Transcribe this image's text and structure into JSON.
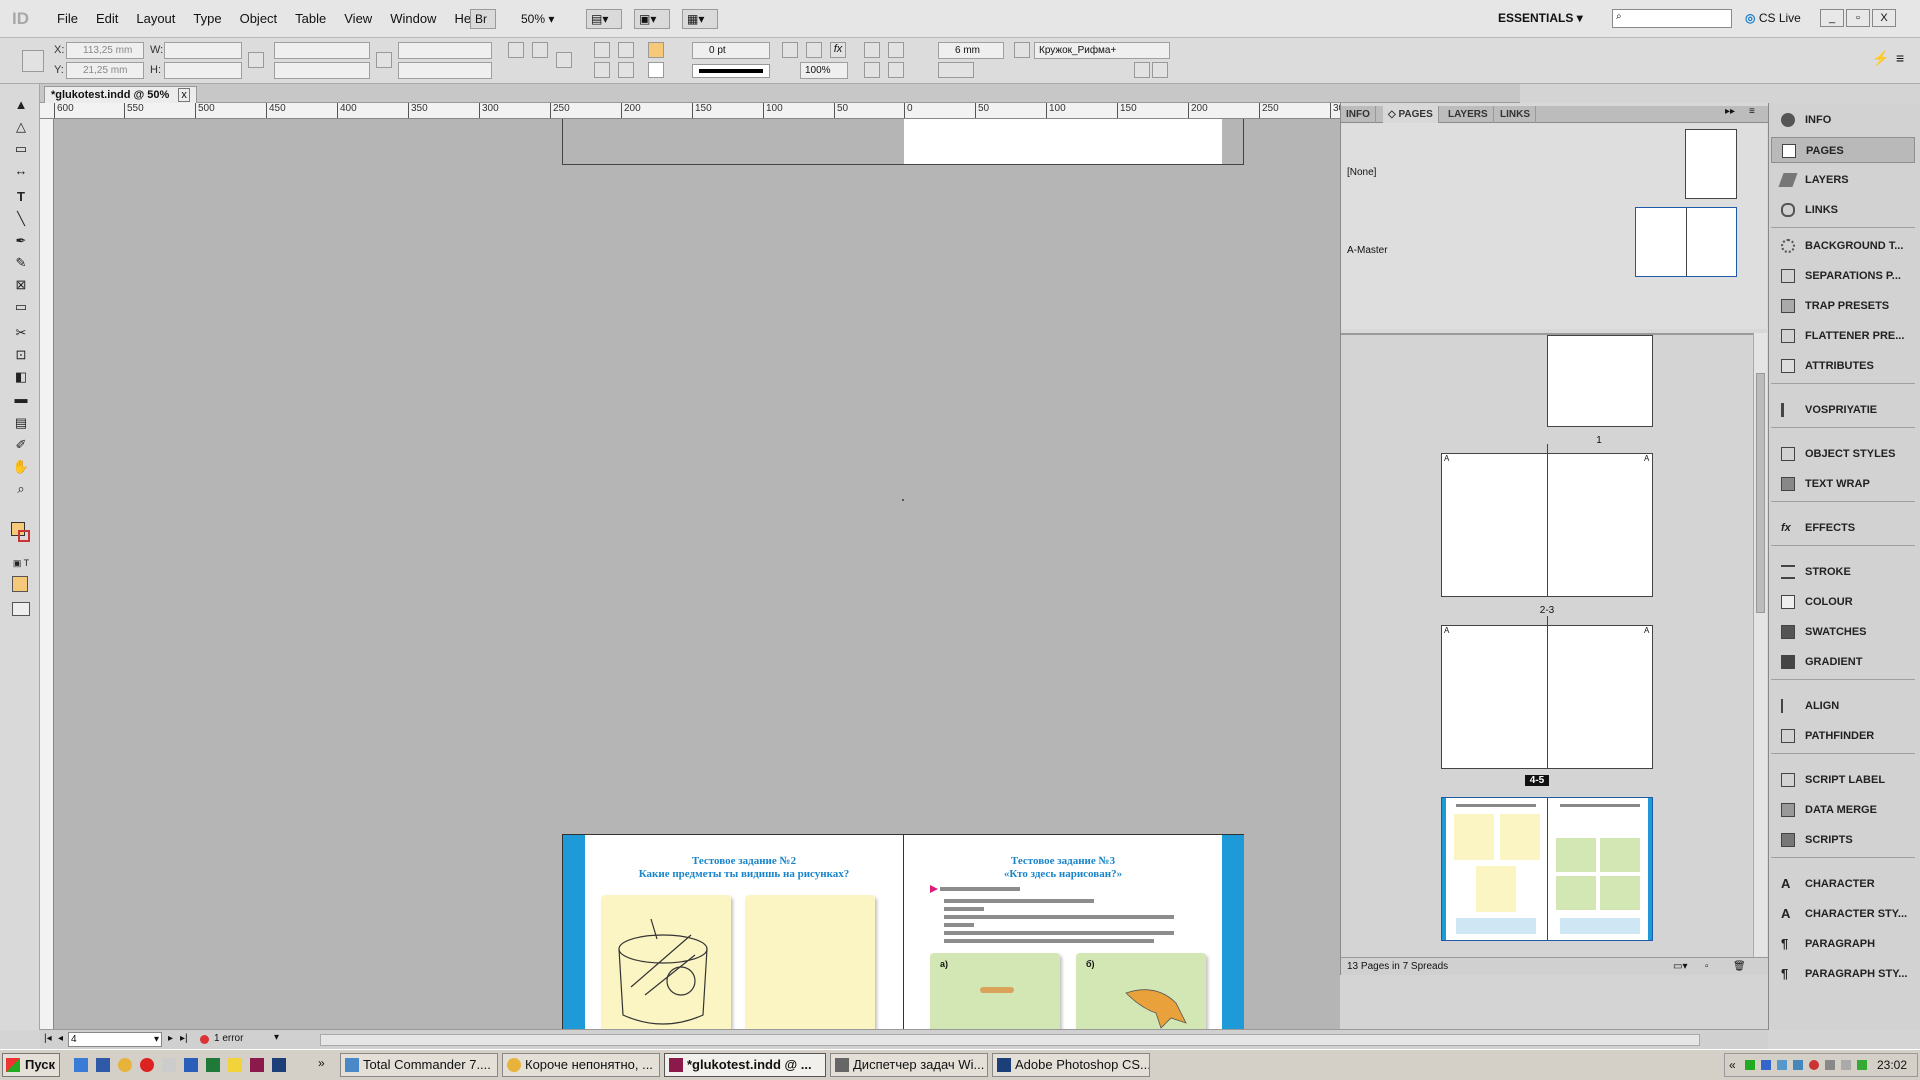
{
  "menubar": {
    "app_logo": "ID",
    "menus": [
      "File",
      "Edit",
      "Layout",
      "Type",
      "Object",
      "Table",
      "View",
      "Window",
      "Help"
    ],
    "bridge_label": "Br",
    "zoom": "50%",
    "workspace": "ESSENTIALS",
    "cs_live": "CS Live",
    "window_min": "_",
    "window_max": "▫",
    "window_close": "X"
  },
  "control": {
    "x_label": "X:",
    "x_value": "113,25 mm",
    "y_label": "Y:",
    "y_value": "21,25 mm",
    "w_label": "W:",
    "h_label": "H:",
    "stroke_weight": "0 pt",
    "opacity": "100%",
    "gutter": "6 mm",
    "object_style": "Кружок_Рифма+"
  },
  "document": {
    "tab_title": "*glukotest.indd @ 50%",
    "close": "x"
  },
  "ruler_ticks": [
    "600",
    "550",
    "500",
    "450",
    "400",
    "350",
    "300",
    "250",
    "200",
    "150",
    "100",
    "50",
    "0",
    "50",
    "100",
    "150",
    "200",
    "250",
    "30"
  ],
  "spread": {
    "left_title_line1": "Тестовое задание №2",
    "left_title_line2": "Какие предметы ты видишь на рисунках?",
    "right_title_line1": "Тестовое задание №3",
    "right_title_line2": "«Кто здесь нарисован?»",
    "card_a": "а)",
    "card_b": "б)"
  },
  "panel": {
    "tabs": [
      "INFO",
      "◇ PAGES",
      "LAYERS",
      "LINKS"
    ],
    "none_label": "[None]",
    "master_label": "A-Master",
    "page_labels": [
      "1",
      "2-3",
      "4-5"
    ],
    "master_marker": "A",
    "footer": "13 Pages in 7 Spreads"
  },
  "dock": {
    "items": [
      "INFO",
      "PAGES",
      "LAYERS",
      "LINKS",
      "BACKGROUND T...",
      "SEPARATIONS P...",
      "TRAP PRESETS",
      "FLATTENER PRE...",
      "ATTRIBUTES",
      "VOSPRIYATIE",
      "OBJECT STYLES",
      "TEXT WRAP",
      "EFFECTS",
      "STROKE",
      "COLOUR",
      "SWATCHES",
      "GRADIENT",
      "ALIGN",
      "PATHFINDER",
      "SCRIPT LABEL",
      "DATA MERGE",
      "SCRIPTS",
      "CHARACTER",
      "CHARACTER STY...",
      "PARAGRAPH",
      "PARAGRAPH STY..."
    ]
  },
  "status": {
    "page": "4",
    "errors": "1 error"
  },
  "taskbar": {
    "start": "Пуск",
    "tasks": [
      "Total Commander 7....",
      "Короче непонятно, ...",
      "*glukotest.indd @ ...",
      "Диспетчер задач Wi...",
      "Adobe Photoshop CS..."
    ],
    "clock": "23:02"
  },
  "colors": {
    "accent_blue": "#1f9ad8",
    "spread_title": "#1a85c9",
    "card_yellow": "#fbf5c4",
    "card_green": "#d3e7b4",
    "pink_marker": "#e0197a"
  }
}
